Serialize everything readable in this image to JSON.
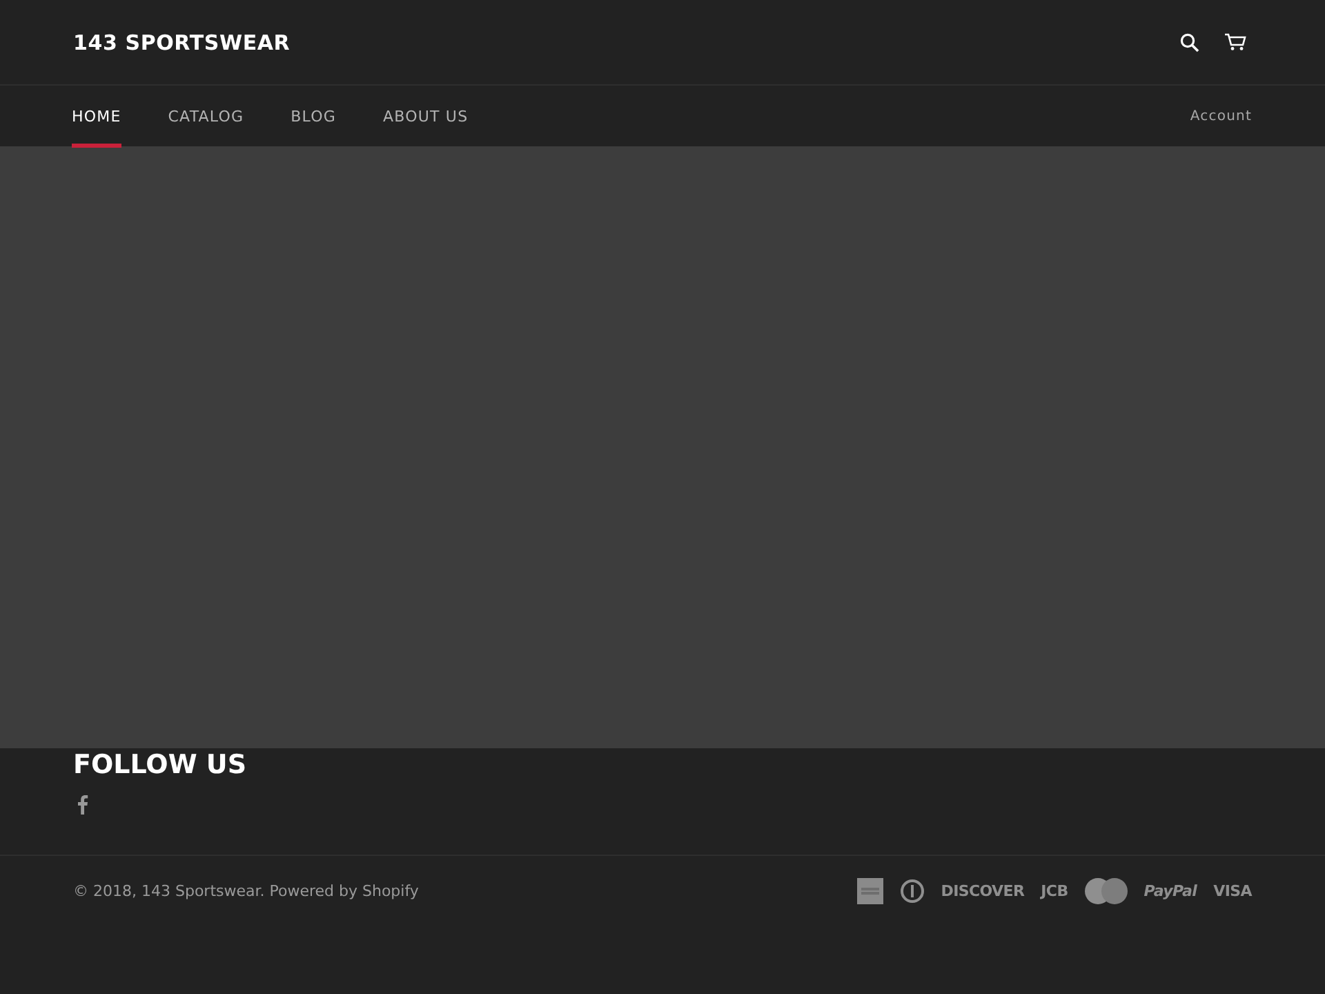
{
  "header": {
    "logo": "143 SPORTSWEAR"
  },
  "nav": {
    "items": [
      {
        "label": "HOME",
        "selected": true
      },
      {
        "label": "CATALOG",
        "selected": false
      },
      {
        "label": "BLOG",
        "selected": false
      },
      {
        "label": "ABOUT US",
        "selected": false
      }
    ],
    "account": "Account"
  },
  "hero": {
    "kind": "empty"
  },
  "footer": {
    "heading": "FOLLOW US",
    "social": [
      {
        "kind": "facebook"
      }
    ],
    "copyright": "© 2018, 143 Sportswear. Powered by Shopify",
    "payments": [
      {
        "kind": "amex"
      },
      {
        "kind": "diners"
      },
      {
        "kind": "text",
        "label": "DISCOVER"
      },
      {
        "kind": "text",
        "label": "JCB"
      },
      {
        "kind": "mastercard"
      },
      {
        "kind": "text",
        "label": "PayPal"
      },
      {
        "kind": "text",
        "label": "VISA"
      }
    ]
  }
}
